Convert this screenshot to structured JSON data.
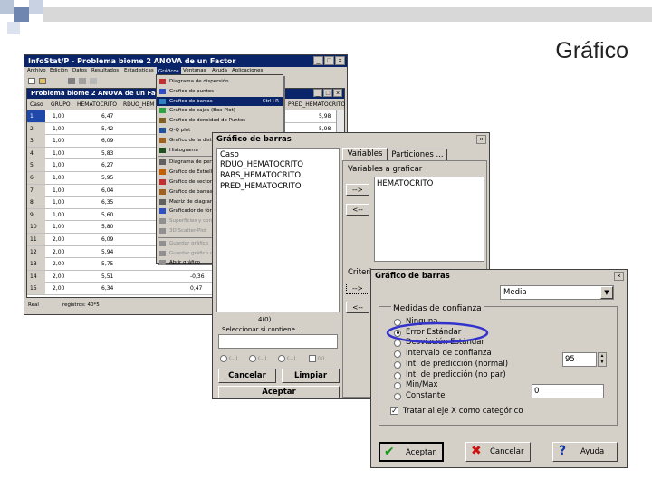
{
  "slide": {
    "title": "Gráfico"
  },
  "main_window": {
    "title": "InfoStat/P - Problema biome 2 ANOVA de un Factor",
    "menu": [
      "Archivo",
      "Edición",
      "Datos",
      "Resultados",
      "Estadísticas",
      "Gráficos",
      "Ventanas",
      "Ayuda",
      "Aplicaciones"
    ],
    "child_title": "Problema biome 2 ANOVA de un Factor",
    "columns": [
      "Caso",
      "GRUPO",
      "HEMATOCRITO",
      "RDUO_HEM"
    ],
    "right_column_header": "PRED_HEMATOCRITO",
    "rows": [
      {
        "caso": "1",
        "grupo": "1,00",
        "hema": "6,47",
        "rduo": "",
        "pred": "5,98"
      },
      {
        "caso": "2",
        "grupo": "1,00",
        "hema": "5,42",
        "rduo": "",
        "pred": "5,98"
      },
      {
        "caso": "3",
        "grupo": "1,00",
        "hema": "6,09",
        "rduo": "",
        "pred": ""
      },
      {
        "caso": "4",
        "grupo": "1,00",
        "hema": "5,83",
        "rduo": "",
        "pred": ""
      },
      {
        "caso": "5",
        "grupo": "1,00",
        "hema": "6,27",
        "rduo": "",
        "pred": ""
      },
      {
        "caso": "6",
        "grupo": "1,00",
        "hema": "5,95",
        "rduo": "",
        "pred": ""
      },
      {
        "caso": "7",
        "grupo": "1,00",
        "hema": "6,04",
        "rduo": "",
        "pred": ""
      },
      {
        "caso": "8",
        "grupo": "1,00",
        "hema": "6,35",
        "rduo": "",
        "pred": ""
      },
      {
        "caso": "9",
        "grupo": "1,00",
        "hema": "5,60",
        "rduo": "",
        "pred": ""
      },
      {
        "caso": "10",
        "grupo": "1,00",
        "hema": "5,80",
        "rduo": "",
        "pred": ""
      },
      {
        "caso": "11",
        "grupo": "2,00",
        "hema": "6,09",
        "rduo": "",
        "pred": ""
      },
      {
        "caso": "12",
        "grupo": "2,00",
        "hema": "5,94",
        "rduo": "",
        "pred": ""
      },
      {
        "caso": "13",
        "grupo": "2,00",
        "hema": "5,75",
        "rduo": "",
        "pred": ""
      },
      {
        "caso": "14",
        "grupo": "2,00",
        "hema": "5,51",
        "rduo": "-0,36",
        "pred": ""
      },
      {
        "caso": "15",
        "grupo": "2,00",
        "hema": "6,34",
        "rduo": "0,47",
        "pred": ""
      }
    ],
    "status": {
      "mode": "Real",
      "records": "registros: 40*5"
    }
  },
  "graficos_menu": {
    "items": [
      "Diagrama de dispersión",
      "Gráfico de puntos",
      "Gráfico de barras",
      "Gráfico de cajas (Box-Plot)",
      "Gráfico de densidad de Puntos",
      "Q-Q plot",
      "Gráfico de la distrib",
      "Histograma",
      "Diagrama de perfile",
      "Gráfico de Estrellas",
      "Gráfico de sectore",
      "Gráfico de barras a",
      "Matriz de diagrama",
      "Graficador de fórm",
      "Superficies y conto",
      "3D Scatter-Plot",
      "Guardar gráfico",
      "Guardar gráfico co",
      "Abrir gráfico"
    ],
    "shortcut": "Ctrl+R"
  },
  "dialog1": {
    "title": "Gráfico de barras",
    "variables": [
      "Caso",
      "RDUO_HEMATOCRITO",
      "RABS_HEMATOCRITO",
      "PRED_HEMATOCRITO"
    ],
    "count": "4(0)",
    "select_label": "Seleccionar si contiene..",
    "tabs": [
      "Variables",
      "Particiones ..."
    ],
    "group_label": "Variables a graficar",
    "selected_var": "HEMATOCRITO",
    "arrow_right": "-->",
    "arrow_left": "<--",
    "criteria_label": "Criteri",
    "cancel": "Cancelar",
    "clear": "Limpiar",
    "accept": "Aceptar"
  },
  "dialog2": {
    "title": "Gráfico de barras",
    "dropdown": "Media",
    "group": "Medidas de confianza",
    "options": [
      "Ninguna",
      "Error Estándar",
      "Desviación Estándar",
      "Intervalo de confianza",
      "Int. de predicción (normal)",
      "Int. de predicción (no par)",
      "Min/Max",
      "Constante"
    ],
    "selected_index": 1,
    "confidence": "95",
    "constant": "0",
    "checkbox_label": "Tratar al eje X como categórico",
    "ok": "Aceptar",
    "cancel": "Cancelar",
    "help": "Ayuda",
    "highlight_color": "#3333cc"
  }
}
